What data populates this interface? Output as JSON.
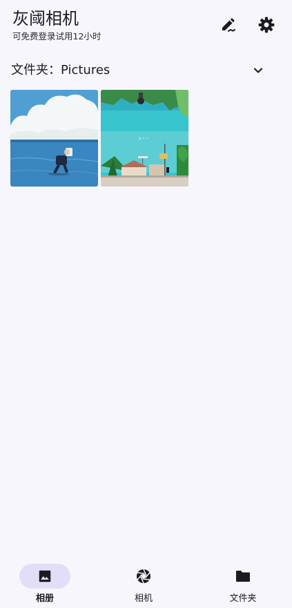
{
  "app": {
    "title": "灰阈相机",
    "subtitle": "可免费登录试用12小时"
  },
  "header": {
    "edit_icon": "edit-icon",
    "settings_icon": "gear-icon"
  },
  "folder": {
    "label": "文件夹：Pictures"
  },
  "photos": [
    {
      "name": "photo-ocean-figure"
    },
    {
      "name": "photo-street-sky"
    }
  ],
  "nav": {
    "items": [
      {
        "label": "相册",
        "icon": "image-icon",
        "active": true
      },
      {
        "label": "相机",
        "icon": "aperture-icon",
        "active": false
      },
      {
        "label": "文件夹",
        "icon": "folder-icon",
        "active": false
      }
    ]
  },
  "colors": {
    "background": "#f8f6fd",
    "active_pill": "#e1dff7",
    "text": "#1c1b1f"
  }
}
